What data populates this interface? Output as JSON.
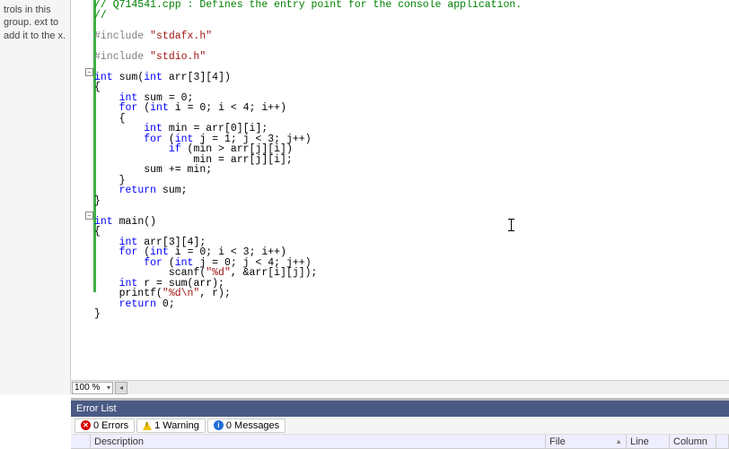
{
  "left_panel": {
    "text": "trols in this group.\next to add it to the\nx."
  },
  "code": {
    "lines": [
      {
        "t": "// Q714541.cpp : Defines the entry point for the console application.",
        "cls": "tok-comment"
      },
      {
        "t": "//",
        "cls": "tok-comment"
      },
      {
        "t": ""
      },
      {
        "segs": [
          {
            "t": "#include ",
            "cls": "tok-pp"
          },
          {
            "t": "\"stdafx.h\"",
            "cls": "tok-string"
          }
        ]
      },
      {
        "t": ""
      },
      {
        "segs": [
          {
            "t": "#include ",
            "cls": "tok-pp"
          },
          {
            "t": "\"stdio.h\"",
            "cls": "tok-string"
          }
        ]
      },
      {
        "t": ""
      },
      {
        "segs": [
          {
            "t": "int",
            "cls": "tok-keyword"
          },
          {
            "t": " sum("
          },
          {
            "t": "int",
            "cls": "tok-keyword"
          },
          {
            "t": " arr[3][4])"
          }
        ]
      },
      {
        "t": "{"
      },
      {
        "segs": [
          {
            "t": "    "
          },
          {
            "t": "int",
            "cls": "tok-keyword"
          },
          {
            "t": " sum = 0;"
          }
        ]
      },
      {
        "segs": [
          {
            "t": "    "
          },
          {
            "t": "for",
            "cls": "tok-keyword"
          },
          {
            "t": " ("
          },
          {
            "t": "int",
            "cls": "tok-keyword"
          },
          {
            "t": " i = 0; i < 4; i++)"
          }
        ]
      },
      {
        "t": "    {"
      },
      {
        "segs": [
          {
            "t": "        "
          },
          {
            "t": "int",
            "cls": "tok-keyword"
          },
          {
            "t": " min = arr[0][i];"
          }
        ]
      },
      {
        "segs": [
          {
            "t": "        "
          },
          {
            "t": "for",
            "cls": "tok-keyword"
          },
          {
            "t": " ("
          },
          {
            "t": "int",
            "cls": "tok-keyword"
          },
          {
            "t": " j = 1; j < 3; j++)"
          }
        ]
      },
      {
        "segs": [
          {
            "t": "            "
          },
          {
            "t": "if",
            "cls": "tok-keyword"
          },
          {
            "t": " (min > arr[j][i])"
          }
        ]
      },
      {
        "t": "                min = arr[j][i];"
      },
      {
        "t": "        sum += min;"
      },
      {
        "t": "    }"
      },
      {
        "segs": [
          {
            "t": "    "
          },
          {
            "t": "return",
            "cls": "tok-keyword"
          },
          {
            "t": " sum;"
          }
        ]
      },
      {
        "t": "}"
      },
      {
        "t": ""
      },
      {
        "segs": [
          {
            "t": "int",
            "cls": "tok-keyword"
          },
          {
            "t": " main()"
          }
        ]
      },
      {
        "t": "{"
      },
      {
        "segs": [
          {
            "t": "    "
          },
          {
            "t": "int",
            "cls": "tok-keyword"
          },
          {
            "t": " arr[3][4];"
          }
        ]
      },
      {
        "segs": [
          {
            "t": "    "
          },
          {
            "t": "for",
            "cls": "tok-keyword"
          },
          {
            "t": " ("
          },
          {
            "t": "int",
            "cls": "tok-keyword"
          },
          {
            "t": " i = 0; i < 3; i++)"
          }
        ]
      },
      {
        "segs": [
          {
            "t": "        "
          },
          {
            "t": "for",
            "cls": "tok-keyword"
          },
          {
            "t": " ("
          },
          {
            "t": "int",
            "cls": "tok-keyword"
          },
          {
            "t": " j = 0; j < 4; j++)"
          }
        ]
      },
      {
        "segs": [
          {
            "t": "            scanf("
          },
          {
            "t": "\"%d\"",
            "cls": "tok-string"
          },
          {
            "t": ", &arr[i][j]);"
          }
        ]
      },
      {
        "segs": [
          {
            "t": "    "
          },
          {
            "t": "int",
            "cls": "tok-keyword"
          },
          {
            "t": " r = sum(arr);"
          }
        ]
      },
      {
        "segs": [
          {
            "t": "    printf("
          },
          {
            "t": "\"%d\\n\"",
            "cls": "tok-string"
          },
          {
            "t": ", r);"
          }
        ]
      },
      {
        "segs": [
          {
            "t": "    "
          },
          {
            "t": "return",
            "cls": "tok-keyword"
          },
          {
            "t": " 0;"
          }
        ]
      },
      {
        "t": "}"
      }
    ]
  },
  "zoom": {
    "value": "100 %"
  },
  "error_list": {
    "title": "Error List",
    "tabs": [
      {
        "icon": "error",
        "label": "0 Errors"
      },
      {
        "icon": "warn",
        "label": "1 Warning"
      },
      {
        "icon": "info",
        "label": "0 Messages"
      }
    ],
    "columns": {
      "desc": "Description",
      "file": "File",
      "line": "Line",
      "column": "Column"
    }
  }
}
